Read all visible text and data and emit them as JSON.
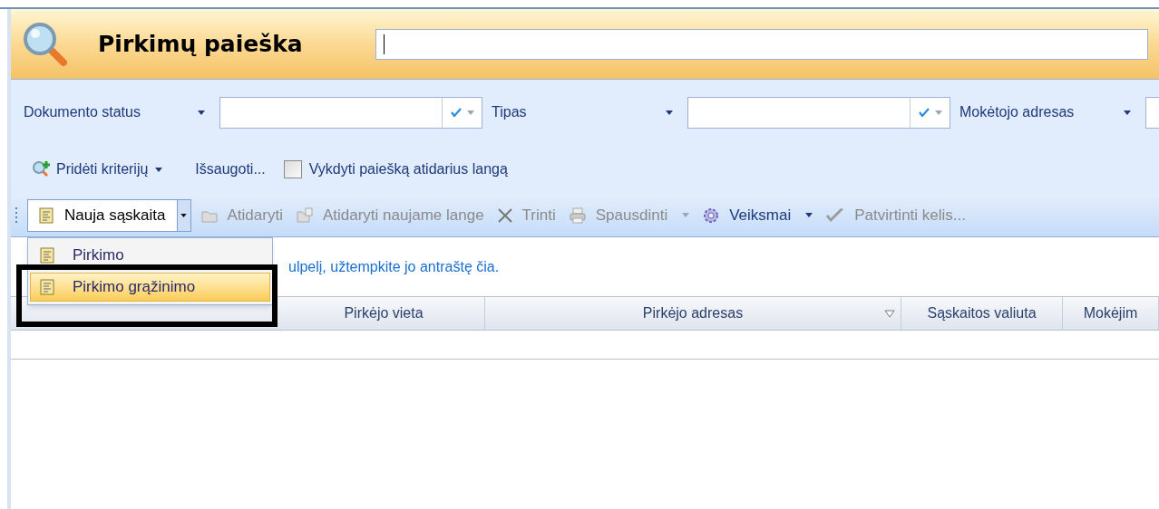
{
  "header": {
    "title": "Pirkimų paieška",
    "search_placeholder_cursor": true
  },
  "filters": [
    {
      "label": "Dokumento status"
    },
    {
      "label": "Tipas"
    },
    {
      "label": "Mokėtojo adresas"
    }
  ],
  "criteria_bar": {
    "add_criteria": "Pridėti kriterijų",
    "save": "Išsaugoti...",
    "auto_search": {
      "label": "Vykdyti paiešką atidarius langą",
      "checked": false
    }
  },
  "toolbar": [
    {
      "kind": "split",
      "label": "Nauja sąskaita",
      "disabled": false,
      "expanded": true
    },
    {
      "kind": "open",
      "label": "Atidaryti",
      "disabled": true
    },
    {
      "kind": "open-new",
      "label": "Atidaryti naujame lange",
      "disabled": true
    },
    {
      "kind": "delete",
      "label": "Trinti",
      "disabled": true
    },
    {
      "kind": "print",
      "label": "Spausdinti",
      "disabled": true
    },
    {
      "kind": "actions",
      "label": "Veiksmai",
      "disabled": false
    },
    {
      "kind": "approve",
      "label": "Patvirtinti kelis...",
      "disabled": true
    }
  ],
  "menu": [
    {
      "label": "Pirkimo",
      "selected": false
    },
    {
      "label": "Pirkimo grąžinimo",
      "selected": true
    }
  ],
  "group_hint": "ulpelį, užtempkite jo antraštę čia.",
  "table": {
    "columns": [
      {
        "label": "Pirkėjo vieta",
        "filter": false
      },
      {
        "label": "Pirkėjo adresas",
        "filter": true
      },
      {
        "label": "Sąskaitos valiuta",
        "filter": false
      },
      {
        "label": "Mokėjim",
        "filter": false
      }
    ]
  }
}
